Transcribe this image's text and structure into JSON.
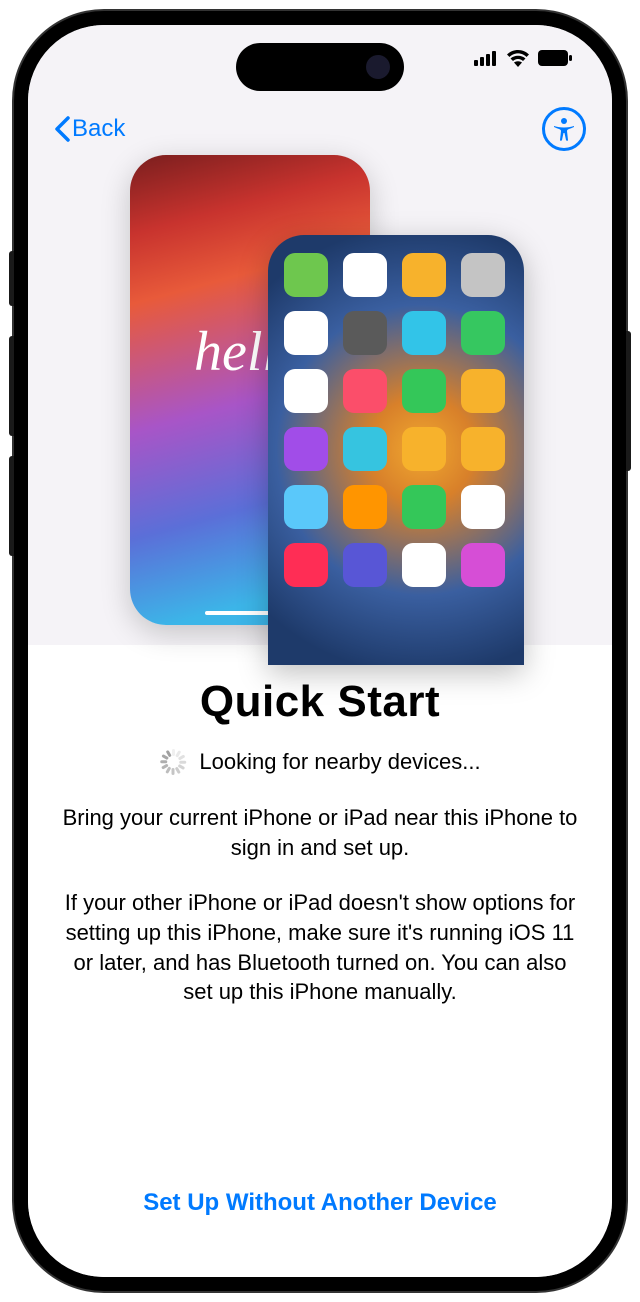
{
  "nav": {
    "back_label": "Back"
  },
  "hero": {
    "hello_text": "hello",
    "app_colors": [
      "#6ec74e",
      "#ffffff",
      "#f7b22c",
      "#c4c4c4",
      "#ffffff",
      "#5a5a5a",
      "#32c4e8",
      "#36c760",
      "#ffffff",
      "#fb4e6a",
      "#34c759",
      "#f7b22c",
      "#a14de8",
      "#36c4e0",
      "#f7b22c",
      "#f7b22c",
      "#5ac8fa",
      "#ff9500",
      "#34c759",
      "#ffffff",
      "#ff2d55",
      "#5856d6",
      "#ffffff",
      "#d64ed6"
    ]
  },
  "content": {
    "title": "Quick Start",
    "loading_text": "Looking for nearby devices...",
    "paragraph1": "Bring your current iPhone or iPad near this iPhone to sign in and set up.",
    "paragraph2": "If your other iPhone or iPad doesn't show options for setting up this iPhone, make sure it's running iOS 11 or later, and has Bluetooth turned on. You can also set up this iPhone manually."
  },
  "footer": {
    "setup_without_label": "Set Up Without Another Device"
  }
}
